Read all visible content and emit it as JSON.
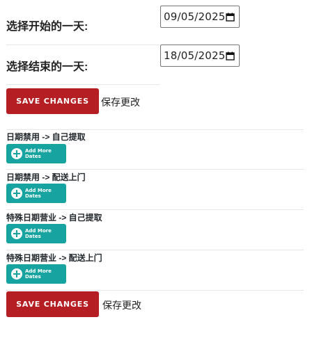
{
  "start": {
    "label": "选择开始的一天:",
    "value": "09/05/2025"
  },
  "end": {
    "label": "选择结束的一天:",
    "value": "18/05/2025"
  },
  "save": {
    "button_label": "SAVE CHANGES",
    "text": "保存更改"
  },
  "sections": [
    {
      "title": "日期禁用 -> 自己提取",
      "button_label": "Add More Dates"
    },
    {
      "title": "日期禁用 -> 配送上门",
      "button_label": "Add More Dates"
    },
    {
      "title": "特殊日期营业 -> 自己提取",
      "button_label": "Add More Dates"
    },
    {
      "title": "特殊日期营业 -> 配送上门",
      "button_label": "Add More Dates"
    }
  ],
  "colors": {
    "save_button": "#b51f24",
    "add_button": "#17a4a1"
  }
}
